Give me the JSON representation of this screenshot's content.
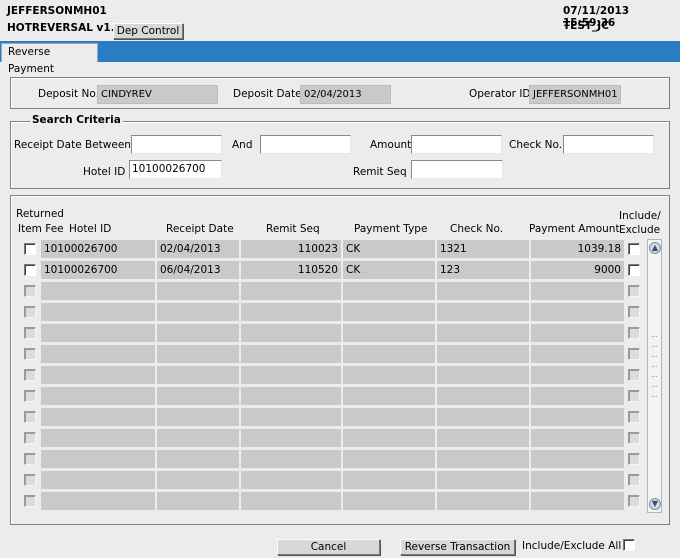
{
  "header": {
    "user": "JEFFERSONMH01",
    "app": "HOTREVERSAL v1.1",
    "datetime": "07/11/2013 15:59:36",
    "env": "TEST_JC",
    "dep_control_label": "Dep Control"
  },
  "tab": {
    "label": "Reverse Payment"
  },
  "deposit": {
    "no_label": "Deposit No.",
    "no_value": "CINDYREV",
    "date_label": "Deposit Date",
    "date_value": "02/04/2013",
    "operator_label": "Operator ID",
    "operator_value": "JEFFERSONMH01"
  },
  "search": {
    "legend": "Search Criteria",
    "receipt_between_label": "Receipt Date Between",
    "receipt_from_value": "",
    "and_label": "And",
    "receipt_to_value": "",
    "amount_label": "Amount",
    "amount_value": "",
    "check_label": "Check No.",
    "check_value": "",
    "hotel_label": "Hotel ID",
    "hotel_value": "10100026700",
    "remit_label": "Remit Seq",
    "remit_value": ""
  },
  "table": {
    "headers": {
      "returned_line1": "Returned",
      "returned_line2": "Item Fee",
      "hotel_id": "Hotel ID",
      "receipt_date": "Receipt Date",
      "remit_seq": "Remit Seq",
      "payment_type": "Payment Type",
      "check_no": "Check No.",
      "payment_amount": "Payment Amount",
      "include_line1": "Include/",
      "include_line2": "Exclude"
    },
    "rows": [
      {
        "hotel_id": "10100026700",
        "receipt_date": "02/04/2013",
        "remit_seq": "110023",
        "payment_type": "CK",
        "check_no": "1321",
        "payment_amount": "1039.18"
      },
      {
        "hotel_id": "10100026700",
        "receipt_date": "06/04/2013",
        "remit_seq": "110520",
        "payment_type": "CK",
        "check_no": "123",
        "payment_amount": "9000"
      }
    ],
    "empty_row_count": 11
  },
  "footer": {
    "cancel_label": "Cancel",
    "reverse_label": "Reverse Transaction",
    "include_all_label": "Include/Exclude All"
  }
}
